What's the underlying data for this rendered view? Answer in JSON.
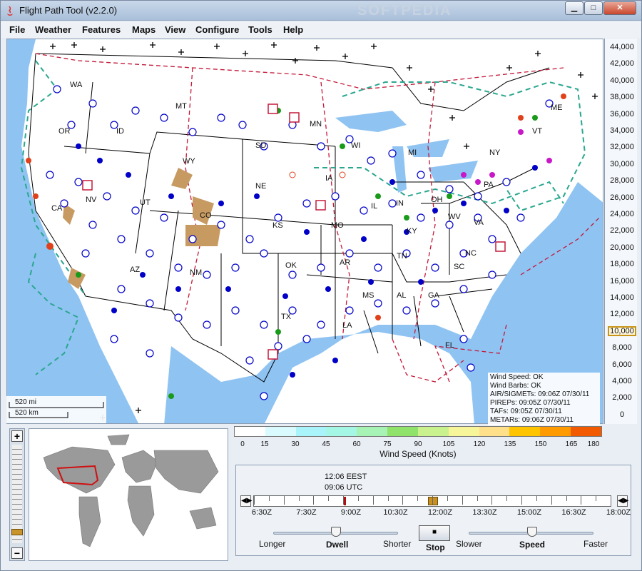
{
  "window": {
    "title": "Flight Path Tool (v2.2.0)",
    "watermark": "SOFTPEDIA"
  },
  "titlebar_buttons": {
    "minimize": "▁",
    "maximize": "□",
    "close": "✕"
  },
  "menus": [
    "File",
    "Weather",
    "Features",
    "Maps",
    "View",
    "Configure",
    "Tools",
    "Help"
  ],
  "altitudes": [
    "44,000",
    "42,000",
    "40,000",
    "38,000",
    "36,000",
    "34,000",
    "32,000",
    "30,000",
    "28,000",
    "26,000",
    "24,000",
    "22,000",
    "20,000",
    "18,000",
    "16,000",
    "14,000",
    "12,000",
    "10,000",
    "8,000",
    "6,000",
    "4,000",
    "2,000",
    "0"
  ],
  "selected_altitude": "10,000",
  "state_labels": [
    "WA",
    "MT",
    "OR",
    "ID",
    "SD",
    "WY",
    "NE",
    "IA",
    "MN",
    "WI",
    "MI",
    "NV",
    "CA",
    "UT",
    "CO",
    "KS",
    "MO",
    "IL",
    "IN",
    "OH",
    "PA",
    "NY",
    "ME",
    "VT",
    "KY",
    "WV",
    "VA",
    "NC",
    "TN",
    "AZ",
    "NM",
    "TX",
    "OK",
    "AR",
    "MS",
    "AL",
    "GA",
    "SC",
    "LA",
    "FL"
  ],
  "map_status": {
    "wind_speed": "Wind Speed: OK",
    "wind_barbs": "Wind Barbs: OK",
    "airsigmets": "AIR/SIGMETs: 09:06Z 07/30/11",
    "pireps": "PIREPs: 09:05Z 07/30/11",
    "tafs": "TAFs: 09:05Z 07/30/11",
    "metars": "METARs: 09:06Z 07/30/11"
  },
  "scale": {
    "miles": "520 mi",
    "km": "520 km"
  },
  "zoom": {
    "plus": "+",
    "minus": "−"
  },
  "legend": {
    "title": "Wind Speed (Knots)",
    "ticks": [
      "0",
      "15",
      "30",
      "45",
      "60",
      "75",
      "90",
      "105",
      "120",
      "135",
      "150",
      "165",
      "180"
    ],
    "colors": [
      "#ffffff",
      "#d9fbff",
      "#a9f4fa",
      "#a3f7e4",
      "#a7f3b6",
      "#8fe36b",
      "#c9f18d",
      "#f7f59a",
      "#ffe08a",
      "#ffc400",
      "#ff9a00",
      "#f15a00",
      "#d10000"
    ]
  },
  "time": {
    "local": "12:06 EEST",
    "utc": "09:06 UTC",
    "labels": [
      "6:30Z",
      "7:30Z",
      "9:00Z",
      "10:30Z",
      "12:00Z",
      "13:30Z",
      "15:00Z",
      "16:30Z",
      "18:00Z"
    ]
  },
  "controls": {
    "longer": "Longer",
    "dwell": "Dwell",
    "shorter": "Shorter",
    "stop": "Stop",
    "slower": "Slower",
    "speed": "Speed",
    "faster": "Faster"
  }
}
